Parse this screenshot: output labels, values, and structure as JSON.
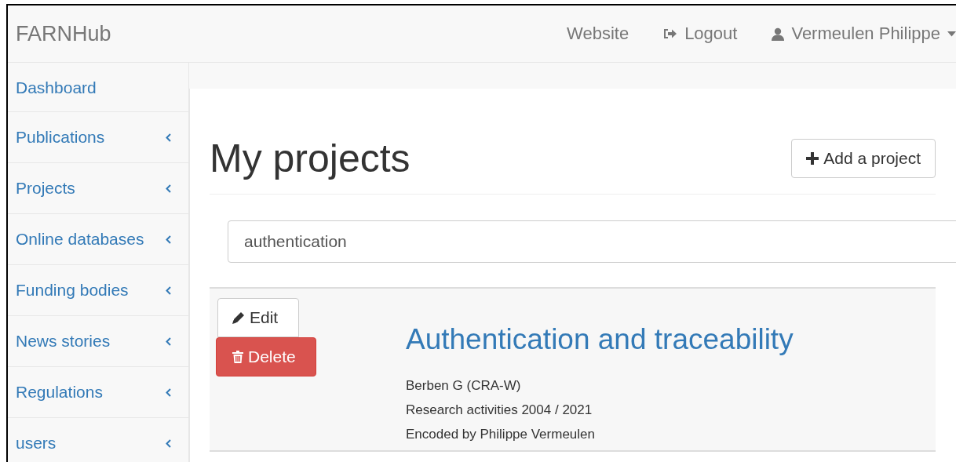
{
  "navbar": {
    "brand": "FARNHub",
    "links": [
      {
        "kind": "plain",
        "label": "Website"
      },
      {
        "kind": "logout",
        "label": "Logout"
      },
      {
        "kind": "user",
        "label": "Vermeulen Philippe"
      }
    ]
  },
  "sidebar": {
    "items": [
      {
        "label": "Dashboard",
        "expandable": false
      },
      {
        "label": "Publications",
        "expandable": true
      },
      {
        "label": "Projects",
        "expandable": true
      },
      {
        "label": "Online databases",
        "expandable": true
      },
      {
        "label": "Funding bodies",
        "expandable": true
      },
      {
        "label": "News stories",
        "expandable": true
      },
      {
        "label": "Regulations",
        "expandable": true
      },
      {
        "label": "users",
        "expandable": true
      }
    ]
  },
  "page": {
    "title": "My projects",
    "add_button": "Add a project",
    "search": {
      "value": "authentication"
    },
    "projects": [
      {
        "edit_button": "Edit",
        "delete_button": "Delete",
        "title": "Authentication and traceability",
        "lines": [
          "Berben G (CRA-W)",
          "Research activities 2004 / 2021",
          "Encoded by Philippe Vermeulen"
        ]
      }
    ]
  }
}
